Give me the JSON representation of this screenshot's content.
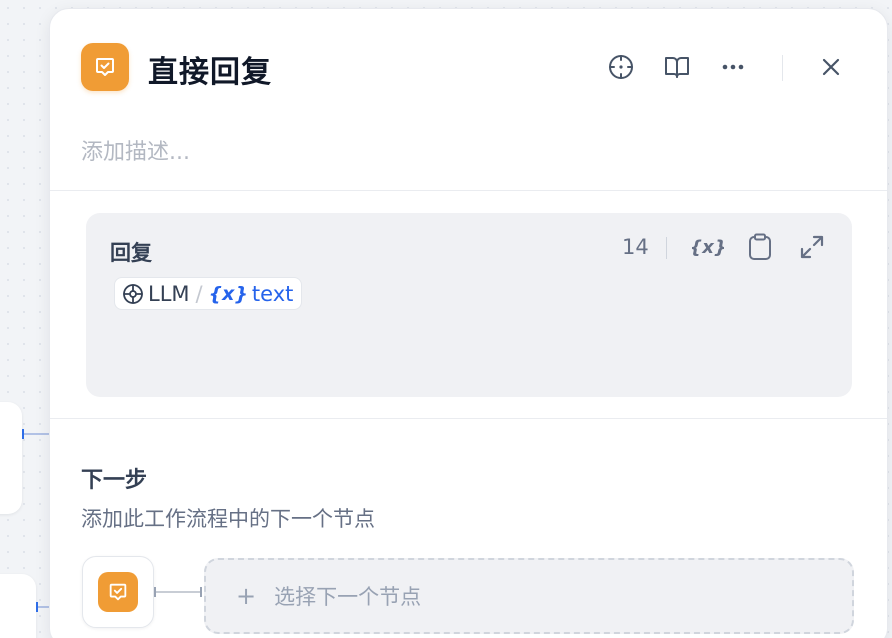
{
  "panel": {
    "title": "直接回复",
    "description_placeholder": "添加描述...",
    "accent_color": "#f09c35",
    "header_icons": [
      "locate-icon",
      "book-icon",
      "more-icon",
      "close-icon"
    ]
  },
  "reply": {
    "label": "回复",
    "char_count": "14",
    "tools": [
      "variable-icon",
      "clipboard-icon",
      "expand-icon"
    ],
    "variable_chip": {
      "source": "LLM",
      "separator": "/",
      "var_symbol": "{x}",
      "var_name": "text"
    }
  },
  "next_step": {
    "title": "下一步",
    "description": "添加此工作流程中的下一个节点",
    "add_symbol": "+",
    "select_label": "选择下一个节点"
  }
}
